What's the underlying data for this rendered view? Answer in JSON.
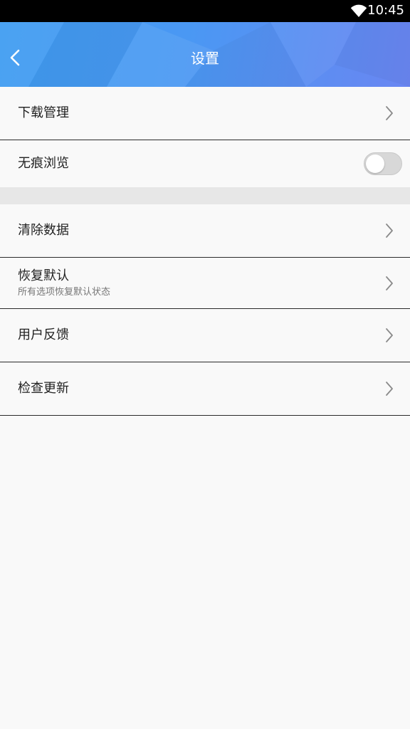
{
  "status_bar": {
    "time": "10:45",
    "wifi_icon": "wifi-icon"
  },
  "header": {
    "title": "设置",
    "back_icon": "back-arrow-icon",
    "colors": {
      "start": "#3f9df2",
      "end": "#6a86f2"
    }
  },
  "settings": {
    "download_manager": {
      "label": "下载管理"
    },
    "incognito": {
      "label": "无痕浏览",
      "enabled": false
    },
    "clear_data": {
      "label": "清除数据"
    },
    "restore_defaults": {
      "label": "恢复默认",
      "description": "所有选项恢复默认状态"
    },
    "feedback": {
      "label": "用户反馈"
    },
    "check_update": {
      "label": "检查更新"
    }
  }
}
